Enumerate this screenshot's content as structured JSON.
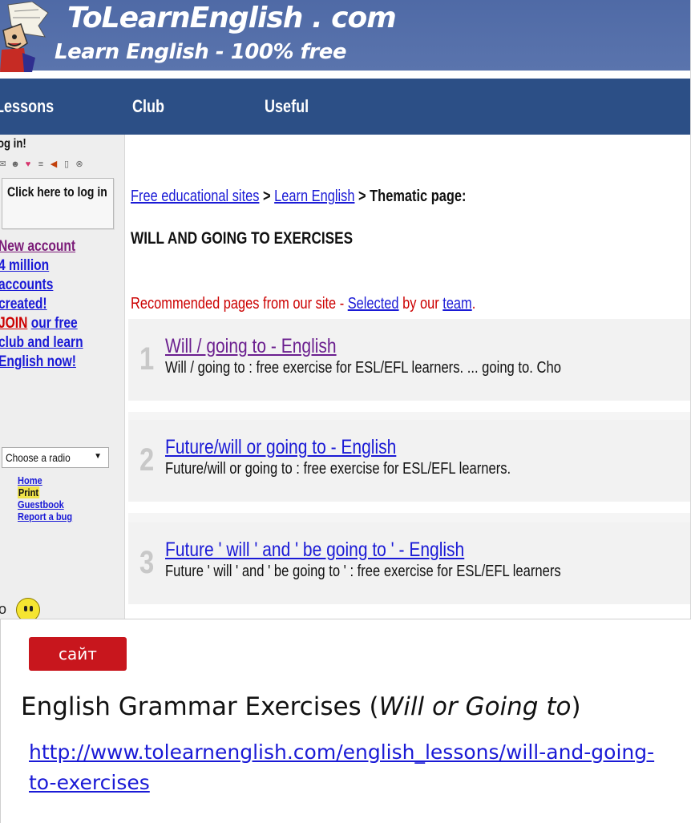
{
  "site": {
    "name": "ToLearnEnglish . com",
    "tagline": "Learn English - 100% free"
  },
  "nav": {
    "items": [
      {
        "label": "Lessons"
      },
      {
        "label": "Club"
      },
      {
        "label": "Useful"
      }
    ]
  },
  "sidebar": {
    "login_title": "og in!",
    "login_button": "Click here to log in",
    "new_account": "New account",
    "accounts_line1": "4 million",
    "accounts_line2": "accounts",
    "accounts_line3": "created!",
    "join_word": "JOIN",
    "join_rest1": "our free",
    "join_rest2": "club and learn",
    "join_rest3": "English now!",
    "radio_select": "Choose a radio",
    "mini_links": [
      "Home",
      "Print",
      "Guestbook",
      "Report a bug"
    ],
    "smiley_prefix": "o"
  },
  "main": {
    "breadcrumb": {
      "link1": "Free educational sites",
      "sep": ">",
      "link2": "Learn English",
      "current": "Thematic page:"
    },
    "page_title": "WILL AND GOING TO EXERCISES",
    "recommended": {
      "prefix": "Recommended pages from our site - ",
      "selected": "Selected",
      "middle": " by our ",
      "team": "team",
      "end": "."
    },
    "results": [
      {
        "num": "1",
        "title": "Will / going to - English",
        "desc": "Will / going to : free exercise for ESL/EFL learners. ... going to. Cho"
      },
      {
        "num": "2",
        "title": "Future/will or going to - English",
        "desc": "Future/will or going to : free exercise for ESL/EFL learners."
      },
      {
        "num": "3",
        "title": "Future ' will ' and ' be going to ' - English",
        "desc": "Future ' will ' and ' be going to ' : free exercise for ESL/EFL learners"
      }
    ]
  },
  "card": {
    "badge": "сайт",
    "title_plain": "English Grammar Exercises (",
    "title_italic": "Will or Going to",
    "title_end": ")",
    "link": "http://www.tolearnenglish.com/english_lessons/will-and-going-to-exercises"
  },
  "colors": {
    "banner": "#5a74ad",
    "navbar": "#2c4f86",
    "badge": "#c8161d",
    "link": "#1a1ad6",
    "visited": "#6b1f8f",
    "recommended": "#cc0000"
  }
}
